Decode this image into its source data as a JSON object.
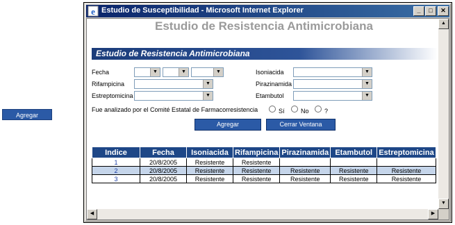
{
  "outer": {
    "add_button": "Agregar"
  },
  "window": {
    "title": "Estudio de Susceptibilidad - Microsoft Internet Explorer",
    "minimize": "_",
    "maximize": "□",
    "close": "✕"
  },
  "page": {
    "heading": "Estudio de Resistencia Antimicrobiana",
    "banner": "Estudio de Resistencia Antimicrobiana"
  },
  "form": {
    "fecha_label": "Fecha",
    "rifampicina_label": "Rifampicina",
    "estreptomicina_label": "Estreptomicina",
    "isoniacida_label": "Isoniacida",
    "pirazinamida_label": "Pirazinamida",
    "etambutol_label": "Etambutol",
    "question": "Fue analizado por el Comité Estatal de Farmacorresistencia",
    "radio_si": "Sí",
    "radio_no": "No",
    "radio_unknown": "?",
    "add_button": "Agregar",
    "close_button": "Cerrar Ventana"
  },
  "table": {
    "headers": [
      "Indice",
      "Fecha",
      "Isoniacida",
      "Rifampicina",
      "Pirazinamida",
      "Etambutol",
      "Estreptomicina"
    ],
    "rows": [
      [
        "1",
        "20/8/2005",
        "Resistente",
        "Resistente",
        "",
        "",
        ""
      ],
      [
        "2",
        "20/8/2005",
        "Resistente",
        "Resistente",
        "Resistente",
        "Resistente",
        "Resistente"
      ],
      [
        "3",
        "20/8/2005",
        "Resistente",
        "Resistente",
        "Resistente",
        "Resistente",
        "Resistente"
      ]
    ]
  },
  "colors": {
    "accent": "#2b5aa6",
    "header": "#1e4787",
    "titlebar": "#0a246a",
    "alt_row": "#c5d5ea"
  }
}
